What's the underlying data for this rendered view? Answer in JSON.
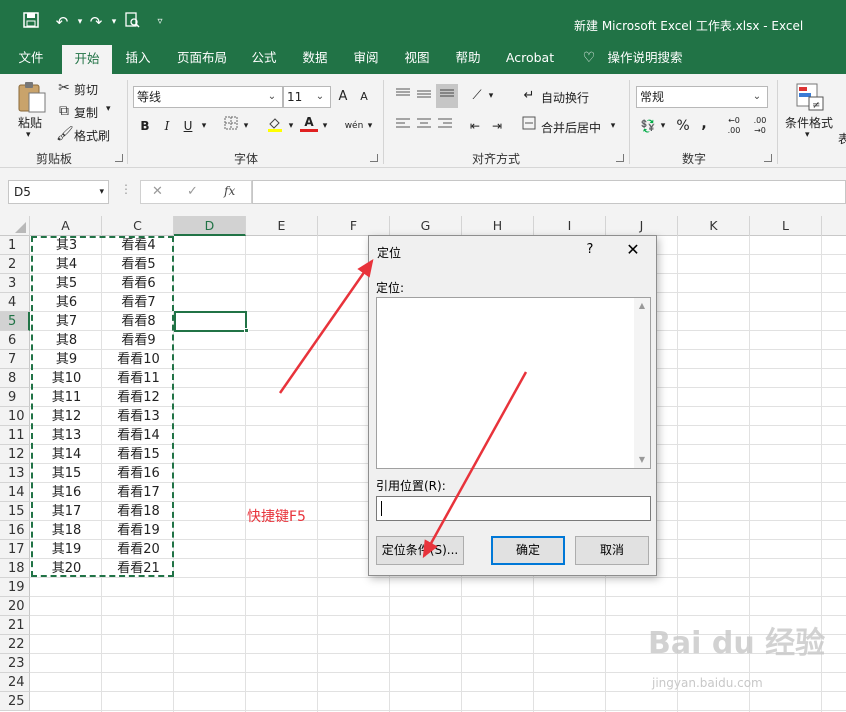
{
  "window": {
    "title": "新建 Microsoft Excel 工作表.xlsx  -  Excel"
  },
  "quick_access": [
    "save-icon",
    "undo-icon",
    "redo-icon",
    "print-preview-icon",
    "customize-icon"
  ],
  "tabs": [
    {
      "label": "文件"
    },
    {
      "label": "开始"
    },
    {
      "label": "插入"
    },
    {
      "label": "页面布局"
    },
    {
      "label": "公式"
    },
    {
      "label": "数据"
    },
    {
      "label": "审阅"
    },
    {
      "label": "视图"
    },
    {
      "label": "帮助"
    },
    {
      "label": "Acrobat"
    },
    {
      "label": "操作说明搜索"
    }
  ],
  "ribbon": {
    "clipboard": {
      "paste": "粘贴",
      "cut": "剪切",
      "copy": "复制",
      "format_painter": "格式刷",
      "group": "剪贴板"
    },
    "font": {
      "name": "等线",
      "size": "11",
      "bold": "B",
      "italic": "I",
      "underline": "U",
      "grow": "A",
      "shrink": "A",
      "font_color": "A",
      "phonetic": "wén",
      "group": "字体"
    },
    "alignment": {
      "wrap": "自动换行",
      "merge": "合并后居中",
      "group": "对齐方式"
    },
    "number": {
      "format": "常规",
      "percent": "%",
      "comma": ",",
      "group": "数字"
    },
    "styles": {
      "conditional": "条件格式",
      "next": "表"
    }
  },
  "formula_bar": {
    "name_box": "D5",
    "fx": "fx",
    "value": ""
  },
  "sheet": {
    "columns": [
      "A",
      "C",
      "D",
      "E",
      "F",
      "G",
      "H",
      "I",
      "J",
      "K",
      "L"
    ],
    "rows": [
      "1",
      "2",
      "3",
      "4",
      "5",
      "6",
      "7",
      "8",
      "9",
      "10",
      "11",
      "12",
      "13",
      "14",
      "15",
      "16",
      "17",
      "18",
      "19",
      "20",
      "21",
      "22",
      "23",
      "24",
      "25"
    ],
    "col_a": [
      "其3",
      "其4",
      "其5",
      "其6",
      "其7",
      "其8",
      "其9",
      "其10",
      "其11",
      "其12",
      "其13",
      "其14",
      "其15",
      "其16",
      "其17",
      "其18",
      "其19",
      "其20"
    ],
    "col_c": [
      "看看4",
      "看看5",
      "看看6",
      "看看7",
      "看看8",
      "看看9",
      "看看10",
      "看看11",
      "看看12",
      "看看13",
      "看看14",
      "看看15",
      "看看16",
      "看看17",
      "看看18",
      "看看19",
      "看看20",
      "看看21"
    ],
    "active_cell": "D5"
  },
  "annotation": "快捷键F5",
  "dialog": {
    "title": "定位",
    "help": "?",
    "list_label": "定位:",
    "reference_label": "引用位置(R):",
    "reference_value": "",
    "special_button": "定位条件(S)...",
    "ok_button": "确定",
    "cancel_button": "取消"
  },
  "watermark": {
    "main": "Bai du 经验",
    "sub": "jingyan.baidu.com"
  },
  "colors": {
    "excel_green": "#217346",
    "arrow_red": "#e8333b",
    "dialog_bg": "#f0f0f0",
    "default_button_border": "#0078d7"
  }
}
